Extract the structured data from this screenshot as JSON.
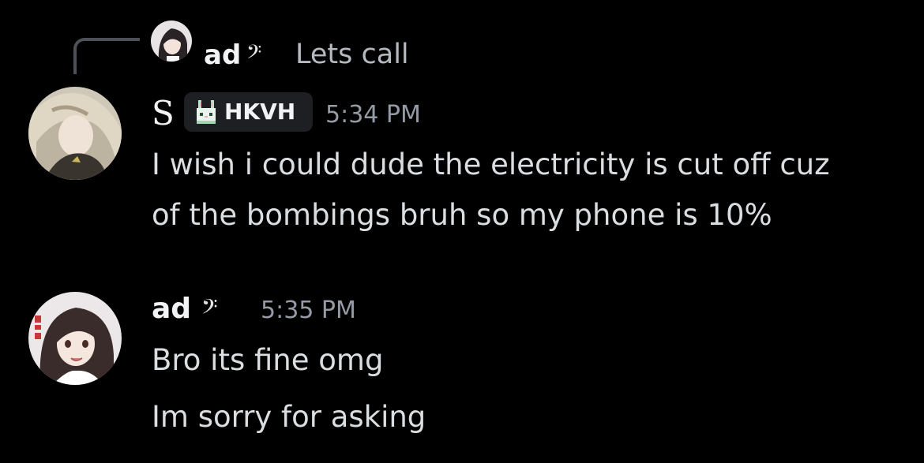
{
  "reply": {
    "author": "ad",
    "author_badge_icon": "bass-clef-icon",
    "author_badge_glyph": "𝄢",
    "preview_text": "Lets call"
  },
  "messages": [
    {
      "author": "S",
      "tag_icon": "bunny-icon",
      "tag_label": "HKVH",
      "timestamp": "5:34 PM",
      "lines": [
        "I wish i could dude the electricity is cut off cuz",
        "of the bombings bruh so my phone is 10%"
      ]
    },
    {
      "author": "ad",
      "author_badge_icon": "bass-clef-icon",
      "author_badge_glyph": "𝄢",
      "timestamp": "5:35 PM",
      "lines": [
        "Bro its fine omg",
        "Im sorry for asking"
      ]
    }
  ],
  "colors": {
    "background": "#000000",
    "text": "#dbdee1",
    "name": "#f2f3f5",
    "timestamp": "#949ba4",
    "tag_background": "#1e1f22",
    "reply_line": "#4e5058"
  }
}
